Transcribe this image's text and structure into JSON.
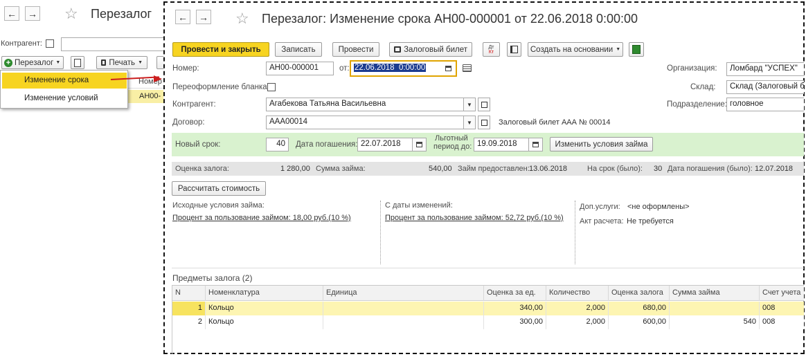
{
  "bg_window": {
    "title": "Перезалог",
    "filter_label": "Контрагент:",
    "toolbar": {
      "perezalog_label": "Перезалог",
      "print_label": "Печать"
    },
    "column_header": "Номер",
    "row_number": "АН00-",
    "menu": {
      "items": [
        "Изменение срока",
        "Изменение условий"
      ]
    }
  },
  "doc": {
    "title": "Перезалог: Изменение срока АН00-000001 от 22.06.2018 0:00:00",
    "toolbar": {
      "post_close": "Провести и закрыть",
      "save": "Записать",
      "post": "Провести",
      "ticket": "Залоговый билет",
      "create_based": "Создать на основании"
    },
    "fields": {
      "number_label": "Номер:",
      "number_value": "АН00-000001",
      "date_label": "от:",
      "date_value": "22.06.2018  0:00:00",
      "reissue_label": "Переоформление бланка:",
      "counterparty_label": "Контрагент:",
      "counterparty_value": "Агабекова Татьяна Васильевна",
      "contract_label": "Договор:",
      "contract_value": "ААА00014",
      "ticket_text": "Залоговый билет ААА № 00014",
      "org_label": "Организация:",
      "org_value": "Ломбард \"УСПЕХ\"",
      "warehouse_label": "Склад:",
      "warehouse_value": "Склад (Залоговый бы",
      "division_label": "Подразделение:",
      "division_value": "головное"
    },
    "green": {
      "new_term_label": "Новый срок:",
      "new_term_value": "40",
      "repay_label": "Дата погашения:",
      "repay_value": "22.07.2018",
      "grace_label_1": "Льготный",
      "grace_label_2": "период до:",
      "grace_value": "19.09.2018",
      "change_button": "Изменить условия займа"
    },
    "summary": {
      "valuation_label": "Оценка залога:",
      "valuation_value": "1 280,00",
      "loan_label": "Сумма займа:",
      "loan_value": "540,00",
      "issued_label": "Займ предоставлен:",
      "issued_value": "13.06.2018",
      "term_was_label": "На срок (было):",
      "term_was_value": "30",
      "repay_was_label": "Дата погашения (было):",
      "repay_was_value": "12.07.2018"
    },
    "calc_button": "Рассчитать стоимость",
    "conditions": {
      "initial_label": "Исходные условия займа:",
      "initial_link": "Процент за пользование займом: 18,00 руб.(10 %)",
      "changed_label": "С даты изменений:",
      "changed_link": "Процент за пользование займом: 52,72 руб.(10 %)",
      "services_label": "Доп.услуги:",
      "services_value": "<не оформлены>",
      "act_label": "Акт расчета:",
      "act_value": "Не требуется"
    },
    "items": {
      "title": "Предметы залога (2)",
      "columns": [
        "N",
        "Номенклатура",
        "Единица",
        "Оценка за ед.",
        "Количество",
        "Оценка залога",
        "Сумма займа",
        "Счет учета"
      ],
      "rows": [
        {
          "n": "1",
          "name": "Кольцо",
          "unit": "",
          "price": "340,00",
          "qty": "2,000",
          "valuation": "680,00",
          "loan": "",
          "account": "008"
        },
        {
          "n": "2",
          "name": "Кольцо",
          "unit": "",
          "price": "300,00",
          "qty": "2,000",
          "valuation": "600,00",
          "loan": "540",
          "account": "008"
        }
      ]
    }
  },
  "colors": {
    "accent_yellow": "#f7d421",
    "green_panel": "#d9f2cf",
    "row_highlight": "#fdf5b2",
    "arrow_red": "#cc1f1f"
  }
}
